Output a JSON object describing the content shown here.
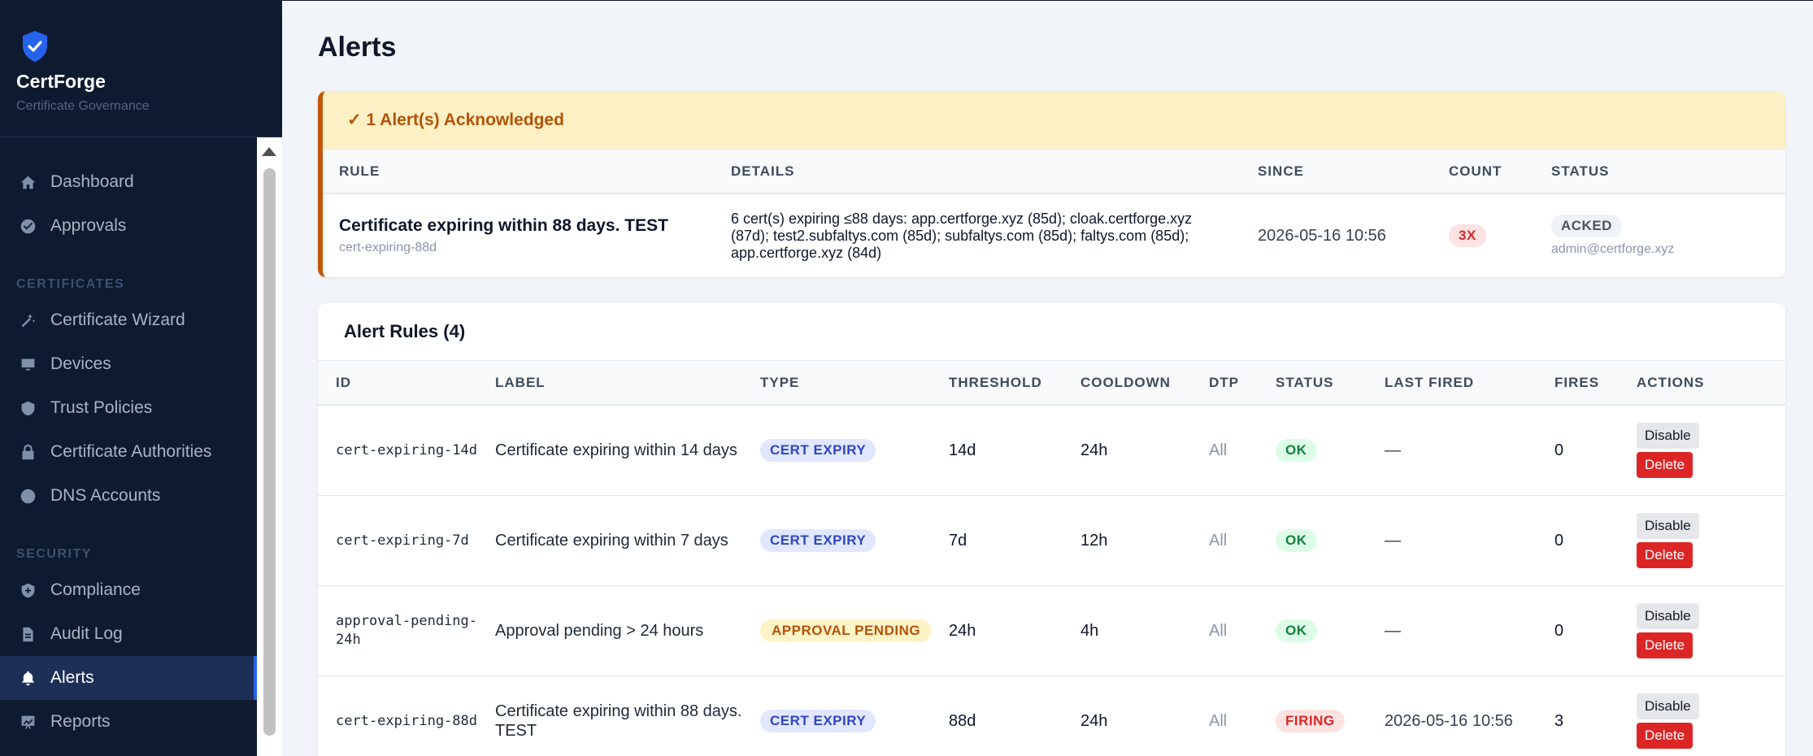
{
  "brand": {
    "name": "CertForge",
    "subtitle": "Certificate Governance",
    "logo_icon": "shield-check-icon",
    "accent": "#2563eb"
  },
  "sidebar": {
    "items_top": [
      {
        "label": "Dashboard",
        "icon": "home-icon"
      },
      {
        "label": "Approvals",
        "icon": "check-circle-icon"
      }
    ],
    "sections": [
      {
        "title": "CERTIFICATES",
        "items": [
          {
            "label": "Certificate Wizard",
            "icon": "magic-wand-icon"
          },
          {
            "label": "Devices",
            "icon": "monitor-icon"
          },
          {
            "label": "Trust Policies",
            "icon": "shield-check-icon"
          },
          {
            "label": "Certificate Authorities",
            "icon": "lock-icon"
          },
          {
            "label": "DNS Accounts",
            "icon": "globe-icon"
          }
        ]
      },
      {
        "title": "SECURITY",
        "items": [
          {
            "label": "Compliance",
            "icon": "shield-plus-icon"
          },
          {
            "label": "Audit Log",
            "icon": "document-icon"
          },
          {
            "label": "Alerts",
            "icon": "bell-icon",
            "active": true
          },
          {
            "label": "Reports",
            "icon": "chart-icon"
          }
        ]
      }
    ]
  },
  "page": {
    "title": "Alerts"
  },
  "ack": {
    "header": "✓ 1 Alert(s) Acknowledged",
    "columns": {
      "rule": "RULE",
      "details": "DETAILS",
      "since": "SINCE",
      "count": "COUNT",
      "status": "STATUS"
    },
    "row": {
      "title": "Certificate expiring within 88 days. TEST",
      "rule_id": "cert-expiring-88d",
      "details": "6 cert(s) expiring ≤88 days: app.certforge.xyz (85d); cloak.certforge.xyz (87d); test2.subfaltys.com (85d); subfaltys.com (85d); faltys.com (85d); app.certforge.xyz (84d)",
      "since": "2026-05-16 10:56",
      "count": "3X",
      "status": "ACKED",
      "acked_by": "admin@certforge.xyz"
    }
  },
  "rules": {
    "header": "Alert Rules (4)",
    "columns": {
      "id": "ID",
      "label": "LABEL",
      "type": "TYPE",
      "threshold": "THRESHOLD",
      "cooldown": "COOLDOWN",
      "dtp": "DTP",
      "status": "STATUS",
      "last_fired": "LAST FIRED",
      "fires": "FIRES",
      "actions": "ACTIONS"
    },
    "rows": [
      {
        "id": "cert-expiring-14d",
        "label": "Certificate expiring within 14 days",
        "type": "CERT EXPIRY",
        "type_kind": "blue",
        "threshold": "14d",
        "cooldown": "24h",
        "dtp": "All",
        "status": "OK",
        "status_kind": "green",
        "last_fired": "—",
        "fires": "0",
        "disable_label": "Disable",
        "delete_label": "Delete"
      },
      {
        "id": "cert-expiring-7d",
        "label": "Certificate expiring within 7 days",
        "type": "CERT EXPIRY",
        "type_kind": "blue",
        "threshold": "7d",
        "cooldown": "12h",
        "dtp": "All",
        "status": "OK",
        "status_kind": "green",
        "last_fired": "—",
        "fires": "0",
        "disable_label": "Disable",
        "delete_label": "Delete"
      },
      {
        "id": "approval-pending-24h",
        "label": "Approval pending > 24 hours",
        "type": "APPROVAL PENDING",
        "type_kind": "amber",
        "threshold": "24h",
        "cooldown": "4h",
        "dtp": "All",
        "status": "OK",
        "status_kind": "green",
        "last_fired": "—",
        "fires": "0",
        "disable_label": "Disable",
        "delete_label": "Delete"
      },
      {
        "id": "cert-expiring-88d",
        "label": "Certificate expiring within 88 days. TEST",
        "type": "CERT EXPIRY",
        "type_kind": "blue",
        "threshold": "88d",
        "cooldown": "24h",
        "dtp": "All",
        "status": "FIRING",
        "status_kind": "red",
        "last_fired": "2026-05-16 10:56",
        "fires": "3",
        "disable_label": "Disable",
        "delete_label": "Delete"
      }
    ]
  }
}
